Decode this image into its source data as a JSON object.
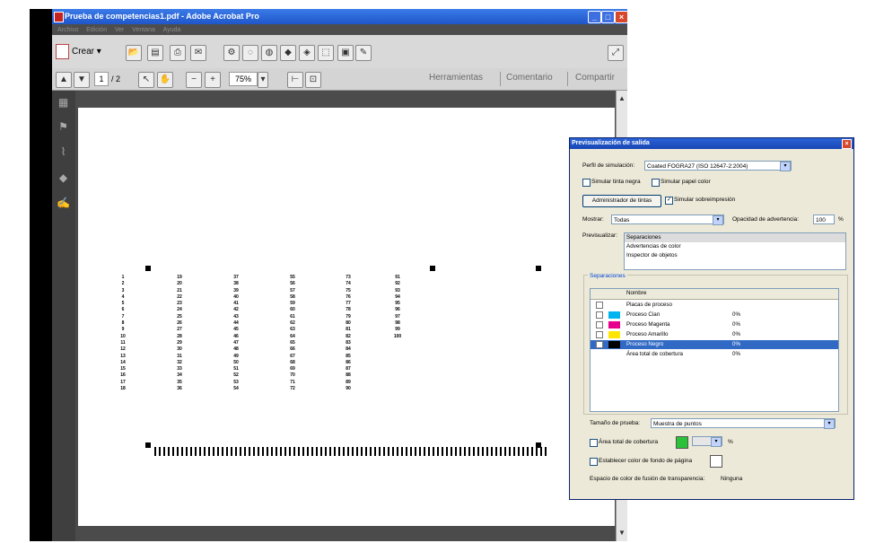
{
  "window": {
    "title": "Prueba de competencias1.pdf - Adobe Acrobat Pro",
    "menu": [
      "Archivo",
      "Edición",
      "Ver",
      "Ventana",
      "Ayuda"
    ]
  },
  "toolbar": {
    "create_label": "Crear",
    "page_current": "1",
    "page_total": "/ 2",
    "zoom": "75%",
    "tools_tab": "Herramientas",
    "comment_tab": "Comentario",
    "share_tab": "Compartir"
  },
  "document": {
    "columns": [
      [
        "1",
        "2",
        "3",
        "4",
        "5",
        "6",
        "7",
        "8",
        "9",
        "10",
        "11",
        "12",
        "13",
        "14",
        "15",
        "16",
        "17",
        "18"
      ],
      [
        "19",
        "20",
        "21",
        "22",
        "23",
        "24",
        "25",
        "26",
        "27",
        "28",
        "29",
        "30",
        "31",
        "32",
        "33",
        "34",
        "35",
        "36"
      ],
      [
        "37",
        "38",
        "39",
        "40",
        "41",
        "42",
        "43",
        "44",
        "45",
        "46",
        "47",
        "48",
        "49",
        "50",
        "51",
        "52",
        "53",
        "54"
      ],
      [
        "55",
        "56",
        "57",
        "58",
        "59",
        "60",
        "61",
        "62",
        "63",
        "64",
        "65",
        "66",
        "67",
        "68",
        "69",
        "70",
        "71",
        "72"
      ],
      [
        "73",
        "74",
        "75",
        "76",
        "77",
        "78",
        "79",
        "80",
        "81",
        "82",
        "83",
        "84",
        "85",
        "86",
        "87",
        "88",
        "89",
        "90"
      ],
      [
        "91",
        "92",
        "93",
        "94",
        "95",
        "96",
        "97",
        "98",
        "99",
        "100"
      ]
    ]
  },
  "dialog": {
    "title": "Previsualización de salida",
    "sim_profile_label": "Perfil de simulación:",
    "sim_profile_value": "Coated FOGRA27 (ISO 12647-2:2004)",
    "sim_black_ink": "Simular tinta negra",
    "sim_paper_color": "Simular papel color",
    "ink_manager": "Administrador de tintas",
    "sim_overprint": "Simular sobreimpresión",
    "show_label": "Mostrar:",
    "show_value": "Todas",
    "warning_opacity_label": "Opacidad de advertencia:",
    "warning_opacity_value": "100",
    "warning_opacity_unit": "%",
    "preview_label": "Previsualizar:",
    "preview_options": [
      "Separaciones",
      "Advertencias de color",
      "Inspector de objetos"
    ],
    "separations_group": "Separaciones",
    "table_header": "Nombre",
    "rows": [
      {
        "name": "Placas de proceso",
        "percent": "",
        "swatch": "",
        "checked": ""
      },
      {
        "name": "Proceso Cian",
        "percent": "0%",
        "swatch": "#00b4f0",
        "checked": ""
      },
      {
        "name": "Proceso Magenta",
        "percent": "0%",
        "swatch": "#e6008c",
        "checked": ""
      },
      {
        "name": "Proceso Amarillo",
        "percent": "0%",
        "swatch": "#ffe600",
        "checked": ""
      },
      {
        "name": "Proceso Negro",
        "percent": "0%",
        "swatch": "#000000",
        "checked": "✓"
      },
      {
        "name": "Área total de cobertura",
        "percent": "0%",
        "swatch": "",
        "checked": ""
      }
    ],
    "sample_size_label": "Tamaño de prueba:",
    "sample_size_value": "Muestra de puntos",
    "total_coverage_label": "Área total de cobertura",
    "total_coverage_unit": "%",
    "page_bg_label": "Establecer color de fondo de página",
    "blend_space_label": "Espacio de color de fusión de transparencia:",
    "blend_space_value": "Ninguna"
  }
}
